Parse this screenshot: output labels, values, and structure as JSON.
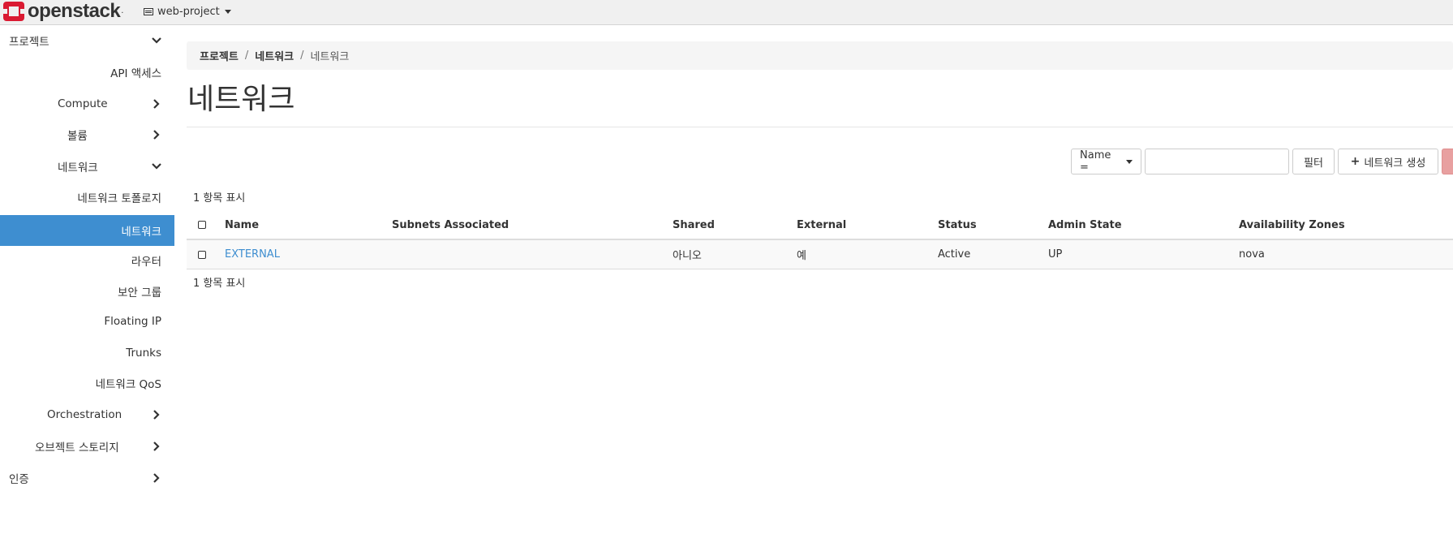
{
  "app": {
    "logo_text": "openstack",
    "logo_trademark": ".",
    "brand_color": "#da1a32"
  },
  "project_selector": {
    "label": "web-project"
  },
  "sidebar": {
    "items": [
      {
        "label": "프로젝트",
        "chevron": "down"
      },
      {
        "label": "API 액세스"
      },
      {
        "label": "Compute",
        "chevron": "right"
      },
      {
        "label": "볼륨",
        "chevron": "right"
      },
      {
        "label": "네트워크",
        "chevron": "down"
      },
      {
        "label": "네트워크 토폴로지"
      },
      {
        "label": "네트워크",
        "active": true
      },
      {
        "label": "라우터"
      },
      {
        "label": "보안 그룹"
      },
      {
        "label": "Floating IP"
      },
      {
        "label": "Trunks"
      },
      {
        "label": "네트워크 QoS"
      },
      {
        "label": "Orchestration",
        "chevron": "right"
      },
      {
        "label": "오브젝트 스토리지",
        "chevron": "right"
      },
      {
        "label": "인증",
        "chevron": "right"
      }
    ],
    "active_color": "#3e8ed0"
  },
  "breadcrumb": {
    "items": [
      "프로젝트",
      "네트워크",
      "네트워크"
    ],
    "separator": "/"
  },
  "page_title": "네트워크",
  "filter": {
    "field_label": "Name =",
    "input_value": "",
    "filter_button": "필터",
    "create_button": "네트워크 생성"
  },
  "count_top": "1 항목 표시",
  "count_bottom": "1 항목 표시",
  "table": {
    "headers": [
      "Name",
      "Subnets Associated",
      "Shared",
      "External",
      "Status",
      "Admin State",
      "Availability Zones"
    ],
    "rows": [
      {
        "name": "EXTERNAL",
        "subnets": "",
        "shared": "아니오",
        "external": "예",
        "status": "Active",
        "admin_state": "UP",
        "zones": "nova"
      }
    ]
  }
}
